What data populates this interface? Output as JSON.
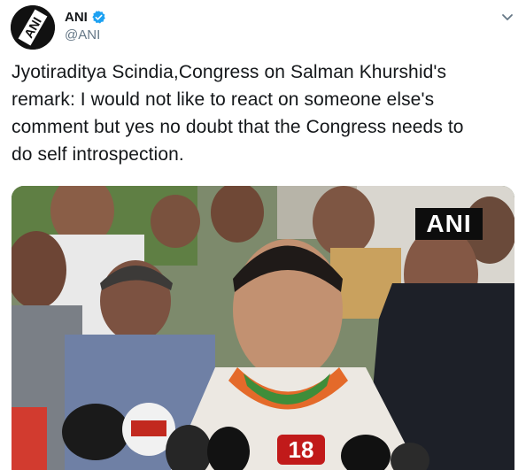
{
  "header": {
    "display_name": "ANI",
    "handle": "@ANI",
    "avatar_text": "ANI",
    "verified_color": "#1da1f2"
  },
  "tweet": {
    "text_lines": [
      "Jyotiraditya Scindia,Congress on Salman Khurshid's",
      "remark: I would not like to react on someone else's",
      "comment but yes no doubt that the Congress needs to",
      "do self introspection."
    ]
  },
  "media": {
    "watermark": "ANI",
    "mic_label": "18"
  },
  "icons": {
    "caret": "chevron-down-icon",
    "verified": "verified-badge-icon"
  }
}
